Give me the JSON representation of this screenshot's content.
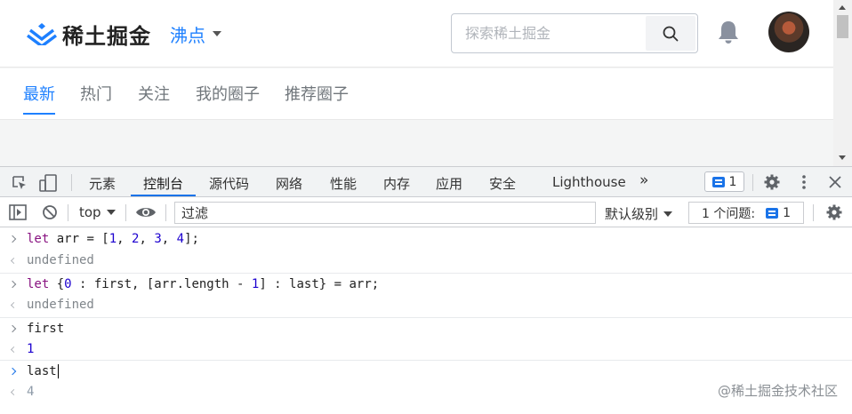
{
  "site": {
    "logo_text": "稀土掘金",
    "nav_dropdown": "沸点",
    "search_placeholder": "探索稀土掘金",
    "tabs": [
      {
        "label": "最新",
        "active": true
      },
      {
        "label": "热门",
        "active": false
      },
      {
        "label": "关注",
        "active": false
      },
      {
        "label": "我的圈子",
        "active": false
      },
      {
        "label": "推荐圈子",
        "active": false
      }
    ],
    "accent": "#1e80ff"
  },
  "devtools": {
    "tabs": [
      {
        "label": "元素",
        "active": false
      },
      {
        "label": "控制台",
        "active": true
      },
      {
        "label": "源代码",
        "active": false
      },
      {
        "label": "网络",
        "active": false
      },
      {
        "label": "性能",
        "active": false
      },
      {
        "label": "内存",
        "active": false
      },
      {
        "label": "应用",
        "active": false
      },
      {
        "label": "安全",
        "active": false
      },
      {
        "label": "Lighthouse",
        "active": false
      }
    ],
    "more_tabs": "»",
    "message_count": "1",
    "context": "top",
    "filter_placeholder": "过滤",
    "level": "默认级别",
    "issues_label": "1 个问题:",
    "issues_count": "1"
  },
  "console": {
    "entries": [
      {
        "input_parts": [
          [
            "kw",
            "let"
          ],
          [
            "t",
            " arr = ["
          ],
          [
            "num",
            "1"
          ],
          [
            "t",
            ", "
          ],
          [
            "num",
            "2"
          ],
          [
            "t",
            ", "
          ],
          [
            "num",
            "3"
          ],
          [
            "t",
            ", "
          ],
          [
            "num",
            "4"
          ],
          [
            "t",
            "];"
          ]
        ],
        "output": "undefined",
        "output_type": "undefined"
      },
      {
        "input_parts": [
          [
            "kw",
            "let"
          ],
          [
            "t",
            " {"
          ],
          [
            "num",
            "0"
          ],
          [
            "t",
            " : first, [arr.length - "
          ],
          [
            "num",
            "1"
          ],
          [
            "t",
            "] : last} = arr;"
          ]
        ],
        "output": "undefined",
        "output_type": "undefined"
      },
      {
        "input_parts": [
          [
            "t",
            "first"
          ]
        ],
        "output": "1",
        "output_type": "number"
      },
      {
        "input_parts": [
          [
            "t",
            "last"
          ]
        ],
        "output": "4",
        "output_type": "number-eager"
      }
    ]
  },
  "watermark": "@稀土掘金技术社区"
}
